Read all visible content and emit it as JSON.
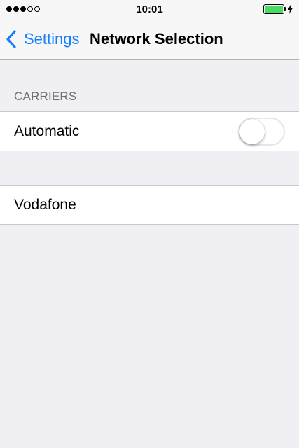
{
  "status_bar": {
    "time": "10:01",
    "signal_bars_filled": 3,
    "signal_bars_total": 5,
    "battery_level": 1.0,
    "charging": true,
    "battery_color": "#4cd964"
  },
  "nav": {
    "back_label": "Settings",
    "title": "Network Selection",
    "accent_color": "#157efb"
  },
  "carriers_section": {
    "header": "CARRIERS",
    "automatic": {
      "label": "Automatic",
      "enabled": false
    }
  },
  "carrier_list": [
    {
      "label": "Vodafone"
    }
  ]
}
